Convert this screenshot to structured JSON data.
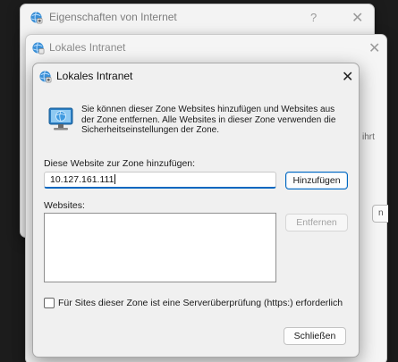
{
  "window_main": {
    "title": "Eigenschaften von Internet",
    "help_glyph": "?",
    "close_glyph": "✕"
  },
  "window_intranet_bg": {
    "title": "Lokales Intranet",
    "close_glyph": "✕",
    "peek_text": "ihrt",
    "peek_button": "n"
  },
  "dialog": {
    "title": "Lokales Intranet",
    "close_glyph": "✕",
    "info_text": "Sie können dieser Zone Websites hinzufügen und Websites aus der Zone entfernen. Alle Websites in dieser Zone verwenden die Sicherheitseinstellungen der Zone.",
    "add_label": "Diese Website zur Zone hinzufügen:",
    "add_value": "10.127.161.111",
    "add_button": "Hinzufügen",
    "websites_label": "Websites:",
    "websites": [],
    "remove_button": "Entfernen",
    "https_checkbox_label": "Für Sites dieser Zone ist eine Serverüberprüfung (https:) erforderlich",
    "https_checked": false,
    "close_button": "Schließen"
  },
  "colors": {
    "accent": "#0067c0",
    "dialog_bg": "#f0f0f0"
  },
  "icons": [
    "internet-options-icon",
    "intranet-zone-icon",
    "close-icon",
    "help-icon"
  ]
}
